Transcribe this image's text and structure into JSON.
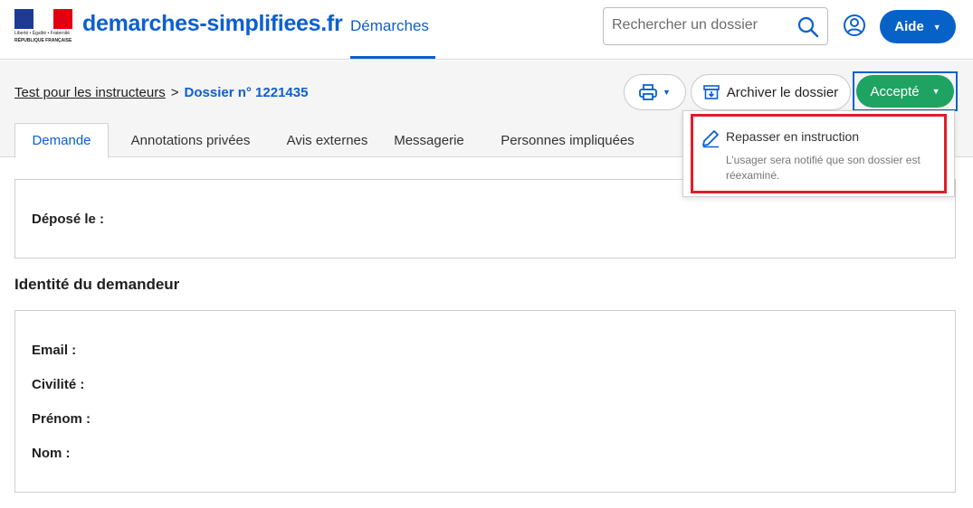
{
  "header": {
    "logo_lines": [
      "Liberté • Égalité • Fraternité",
      "RÉPUBLIQUE FRANÇAISE"
    ],
    "brand": "demarches-simplifiees.fr",
    "nav_demarches": "Démarches",
    "search_placeholder": "Rechercher un dossier",
    "aide_label": "Aide"
  },
  "breadcrumb": {
    "procedure": "Test pour les instructeurs",
    "separator": ">",
    "current": "Dossier n° 1221435"
  },
  "actions": {
    "archive_label": "Archiver le dossier",
    "status_label": "Accepté"
  },
  "tabs": [
    {
      "label": "Demande",
      "active": true
    },
    {
      "label": "Annotations privées",
      "active": false
    },
    {
      "label": "Avis externes",
      "active": false
    },
    {
      "label": "Messagerie",
      "active": false
    },
    {
      "label": "Personnes impliquées",
      "active": false
    }
  ],
  "dropdown": {
    "title": "Repasser en instruction",
    "description": "L’usager sera notifié que son dossier est réexaminé."
  },
  "content": {
    "depose_label": "Déposé le :",
    "identity_title": "Identité du demandeur",
    "fields": [
      "Email :",
      "Civilité :",
      "Prénom :",
      "Nom :"
    ]
  },
  "colors": {
    "primary": "#0c5fd0",
    "success": "#1fa362",
    "highlight": "#e11d2a"
  }
}
